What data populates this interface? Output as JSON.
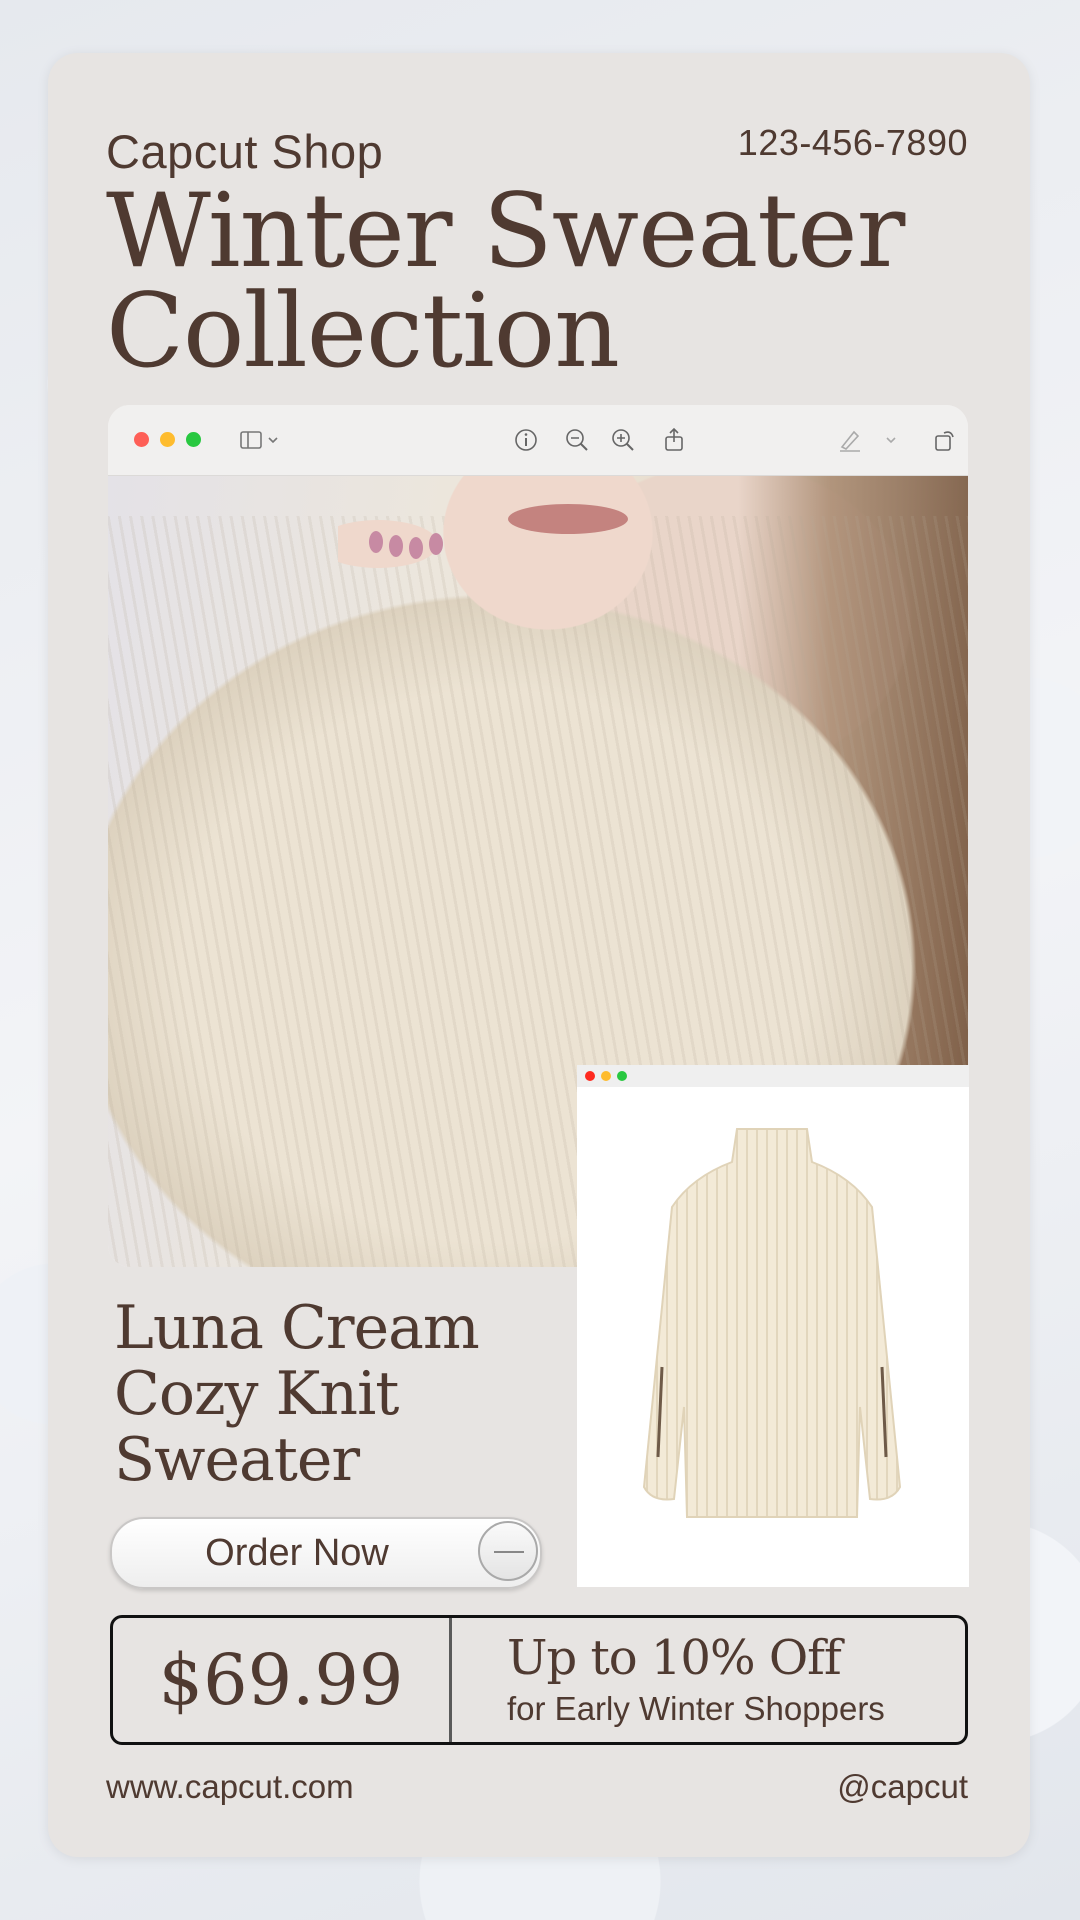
{
  "header": {
    "shop_name": "Capcut Shop",
    "phone": "123-456-7890",
    "title_line1": "Winter Sweater",
    "title_line2": "Collection"
  },
  "preview_window": {
    "controls": [
      "close",
      "minimize",
      "zoom"
    ],
    "toolbar_icons": [
      "sidebar-icon",
      "chevron-down-icon",
      "info-icon",
      "zoom-out-icon",
      "zoom-in-icon",
      "share-icon",
      "highlight-pen-icon",
      "chevron-down-icon",
      "rotate-icon",
      "markup-icon",
      "search-icon"
    ]
  },
  "product": {
    "name_line1": "Luna Cream",
    "name_line2": "Cozy Knit",
    "name_line3": "Sweater",
    "order_label": "Order Now"
  },
  "pricing": {
    "price": "$69.99",
    "offer_title": "Up to 10% Off",
    "offer_subtitle": "for Early Winter Shoppers"
  },
  "footer": {
    "website": "www.capcut.com",
    "handle": "@capcut"
  },
  "colors": {
    "brand_brown": "#4f3a31",
    "card_bg": "#e7e4e2",
    "traffic_red": "#fe5f57",
    "traffic_yellow": "#febc2e",
    "traffic_green": "#28c840"
  }
}
